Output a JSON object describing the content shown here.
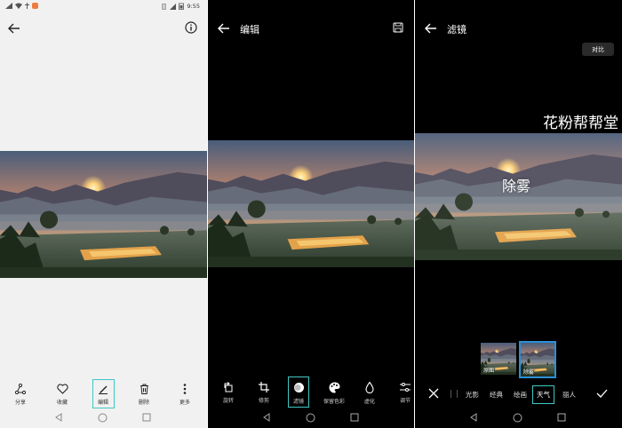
{
  "panel1": {
    "status": {
      "time": "9:55"
    },
    "toolbar": [
      {
        "label": "分享",
        "icon": "share-icon"
      },
      {
        "label": "收藏",
        "icon": "heart-icon"
      },
      {
        "label": "编辑",
        "icon": "pencil-icon"
      },
      {
        "label": "删除",
        "icon": "trash-icon"
      },
      {
        "label": "更多",
        "icon": "more-vertical-icon"
      }
    ]
  },
  "panel2": {
    "title": "编辑",
    "toolbar": [
      {
        "label": "旋转",
        "icon": "rotate-icon"
      },
      {
        "label": "修剪",
        "icon": "crop-icon"
      },
      {
        "label": "滤镜",
        "icon": "filter-icon"
      },
      {
        "label": "保留色彩",
        "icon": "palette-icon"
      },
      {
        "label": "虚化",
        "icon": "drop-icon"
      },
      {
        "label": "调节",
        "icon": "sliders-icon"
      }
    ]
  },
  "panel3": {
    "title": "滤镜",
    "compare_label": "对比",
    "watermark": "花粉帮帮堂",
    "photo_overlay": "除雾",
    "thumbnails": [
      {
        "label": "原图"
      },
      {
        "label": "除雾"
      }
    ],
    "categories": [
      "光影",
      "经典",
      "绘画",
      "天气",
      "丽人"
    ],
    "active_category": "天气"
  },
  "colors": {
    "accent": "#3fc7c4",
    "active_blue": "#2a8fd6"
  }
}
